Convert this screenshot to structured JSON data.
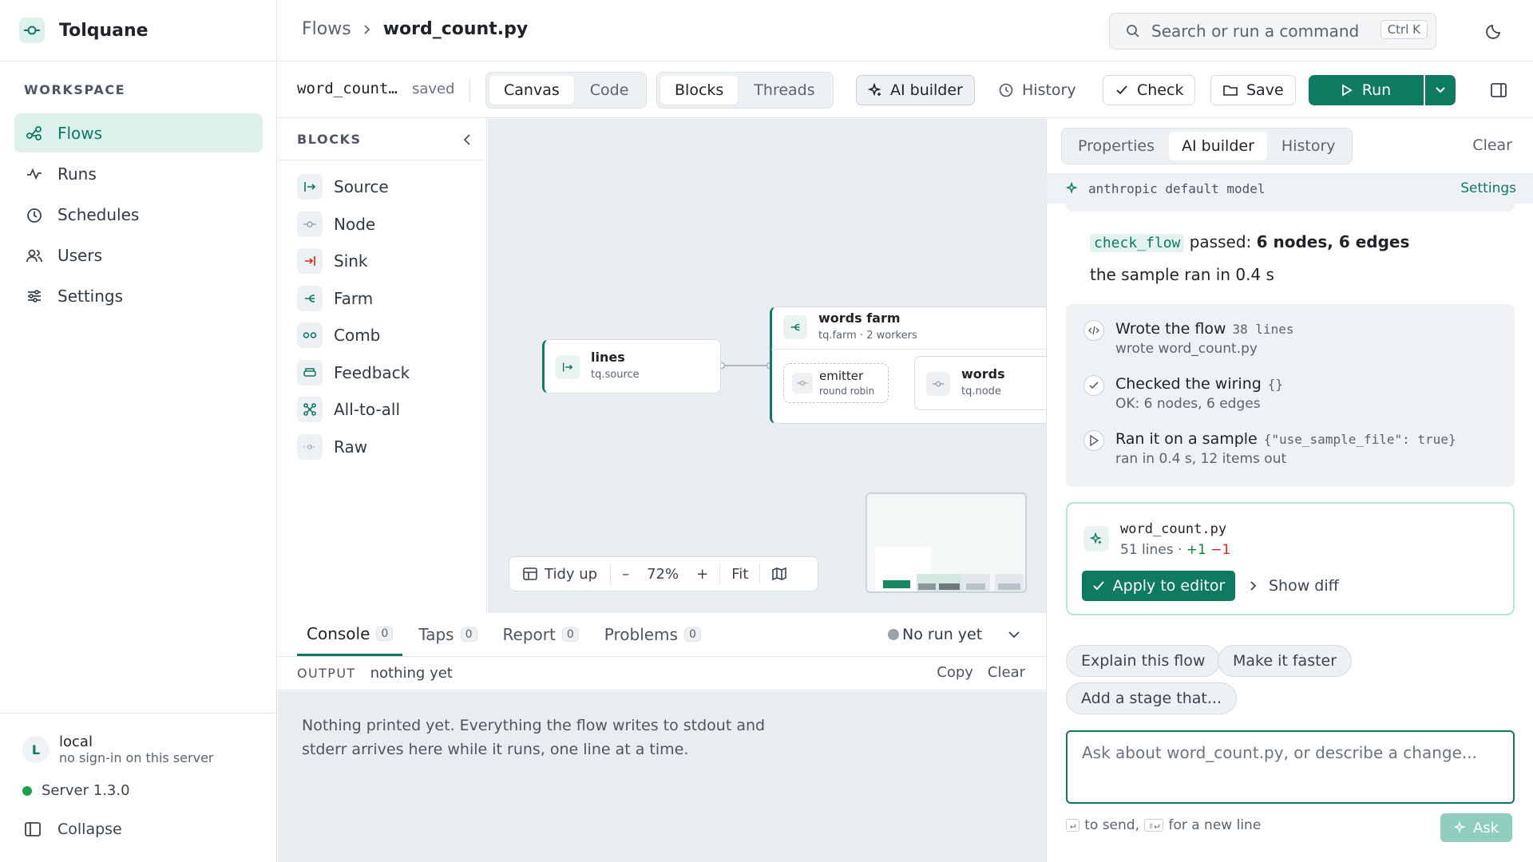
{
  "brand": {
    "name": "Tolquane"
  },
  "sidebar": {
    "section_label": "WORKSPACE",
    "items": [
      {
        "label": "Flows",
        "icon": "flows-icon",
        "active": true
      },
      {
        "label": "Runs",
        "icon": "pulse-icon"
      },
      {
        "label": "Schedules",
        "icon": "clock-icon"
      },
      {
        "label": "Users",
        "icon": "users-icon"
      },
      {
        "label": "Settings",
        "icon": "sliders-icon"
      }
    ],
    "user": {
      "initial": "L",
      "name": "local",
      "sub": "no sign-in on this server"
    },
    "server": "Server 1.3.0",
    "collapse": "Collapse"
  },
  "header": {
    "crumb_root": "Flows",
    "crumb_current": "word_count.py",
    "search_placeholder": "Search or run a command",
    "search_shortcut": "Ctrl K"
  },
  "toolbar": {
    "filename": "word_count…",
    "status": "saved",
    "view_tabs": [
      "Canvas",
      "Code"
    ],
    "view_active": "Canvas",
    "mode_tabs": [
      "Blocks",
      "Threads"
    ],
    "mode_active": "Blocks",
    "ai_builder": "AI builder",
    "history": "History",
    "check": "Check",
    "save": "Save",
    "run": "Run"
  },
  "blocks_panel": {
    "title": "BLOCKS",
    "items": [
      "Source",
      "Node",
      "Sink",
      "Farm",
      "Comb",
      "Feedback",
      "All-to-all",
      "Raw"
    ]
  },
  "canvas": {
    "nodes": {
      "lines": {
        "title": "lines",
        "sub": "tq.source"
      },
      "farm": {
        "title": "words farm",
        "sub": "tq.farm · 2 workers"
      },
      "emitter": {
        "title": "emitter",
        "sub": "round robin"
      },
      "words": {
        "title": "words",
        "sub": "tq.node"
      }
    },
    "zoom": {
      "tidy": "Tidy up",
      "minus": "–",
      "level": "72%",
      "plus": "+",
      "fit": "Fit"
    }
  },
  "console": {
    "tabs": [
      {
        "label": "Console",
        "count": "0"
      },
      {
        "label": "Taps",
        "count": "0"
      },
      {
        "label": "Report",
        "count": "0"
      },
      {
        "label": "Problems",
        "count": "0"
      }
    ],
    "active_tab": "Console",
    "run_status": "No run yet",
    "output_label": "OUTPUT",
    "output_value": "nothing yet",
    "copy": "Copy",
    "clear": "Clear",
    "body": "Nothing printed yet. Everything the flow writes to stdout and stderr arrives here while it runs, one line at a time."
  },
  "ai_panel": {
    "tabs": [
      "Properties",
      "AI builder",
      "History"
    ],
    "active_tab": "AI builder",
    "clear": "Clear",
    "model": "anthropic default model",
    "settings": "Settings",
    "check_chip": "check_flow",
    "passed_text": "passed:",
    "passed_value": "6 nodes, 6 edges",
    "sample_text": "the sample ran in 0.4 s",
    "steps": [
      {
        "title": "Wrote the flow",
        "meta": "38 lines",
        "sub": "wrote word_count.py",
        "icon": "code-icon"
      },
      {
        "title": "Checked the wiring",
        "meta": "{}",
        "sub": "OK: 6 nodes, 6 edges",
        "icon": "check-icon"
      },
      {
        "title": "Ran it on a sample",
        "meta": "{\"use_sample_file\": true}",
        "sub": "ran in 0.4 s, 12 items out",
        "icon": "play-icon"
      }
    ],
    "file": {
      "name": "word_count.py",
      "lines": "51 lines ·",
      "added": "+1",
      "removed": "−1"
    },
    "apply": "Apply to editor",
    "show_diff": "Show diff",
    "suggestions": [
      "Explain this flow",
      "Make it faster",
      "Add a stage that..."
    ],
    "ask_placeholder": "Ask about word_count.py, or describe a change...",
    "hint_send": "to send,",
    "hint_newline": "for a new line",
    "ask": "Ask"
  },
  "colors": {
    "accent": "#0e7a62",
    "accent_light": "#dcf0ec",
    "canvas_bg": "#e8eef0"
  }
}
